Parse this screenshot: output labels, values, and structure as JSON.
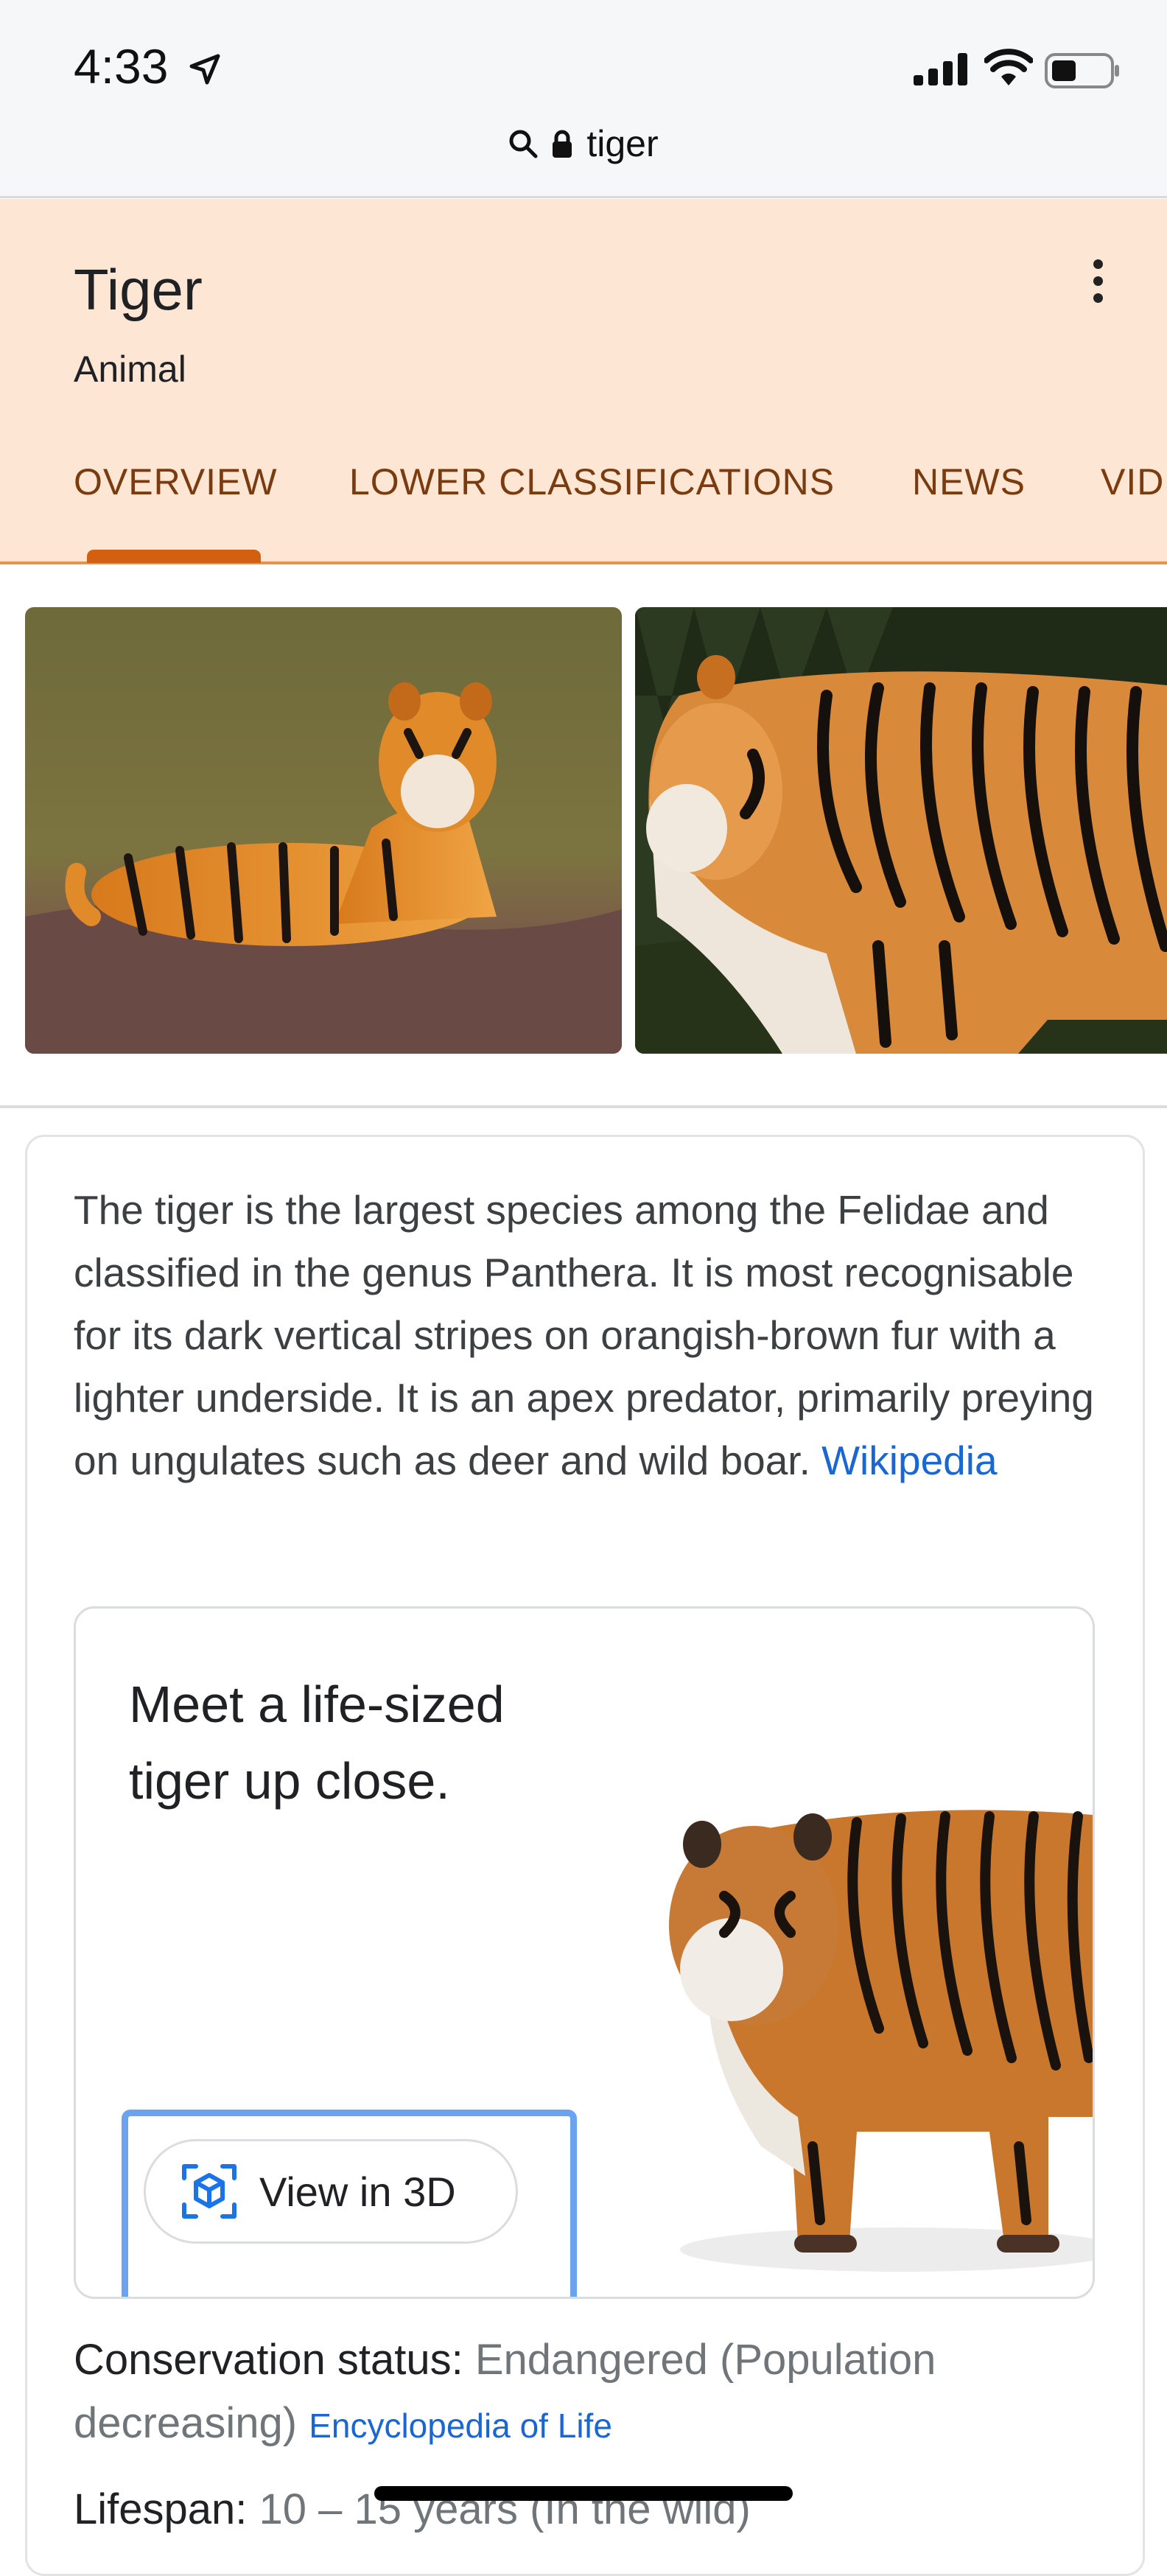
{
  "status_bar": {
    "time": "4:33"
  },
  "address_bar": {
    "query": "tiger"
  },
  "entity": {
    "title": "Tiger",
    "subtitle": "Animal"
  },
  "tabs": [
    {
      "label": "OVERVIEW",
      "selected": true
    },
    {
      "label": "LOWER CLASSIFICATIONS",
      "selected": false
    },
    {
      "label": "NEWS",
      "selected": false
    },
    {
      "label": "VID",
      "selected": false
    }
  ],
  "description": {
    "text": "The tiger is the largest species among the Felidae and classified in the genus Panthera. It is most recognisable for its dark vertical stripes on orangish-brown fur with a lighter underside. It is an apex predator, primarily preying on ungulates such as deer and wild boar.",
    "source_link": "Wikipedia"
  },
  "ar_card": {
    "title": "Meet a life-sized tiger up close.",
    "button_label": "View in 3D"
  },
  "facts": {
    "conservation": {
      "label": "Conservation status:",
      "value": "Endangered (Population decreasing)",
      "source": "Encyclopedia of Life"
    },
    "lifespan": {
      "label": "Lifespan:",
      "value": "10 – 15 years (In the wild)"
    }
  },
  "colors": {
    "header_bg": "#fde6d3",
    "tab_text": "#7a3b0f",
    "tab_indicator": "#d35f10",
    "link": "#1a66d2"
  }
}
